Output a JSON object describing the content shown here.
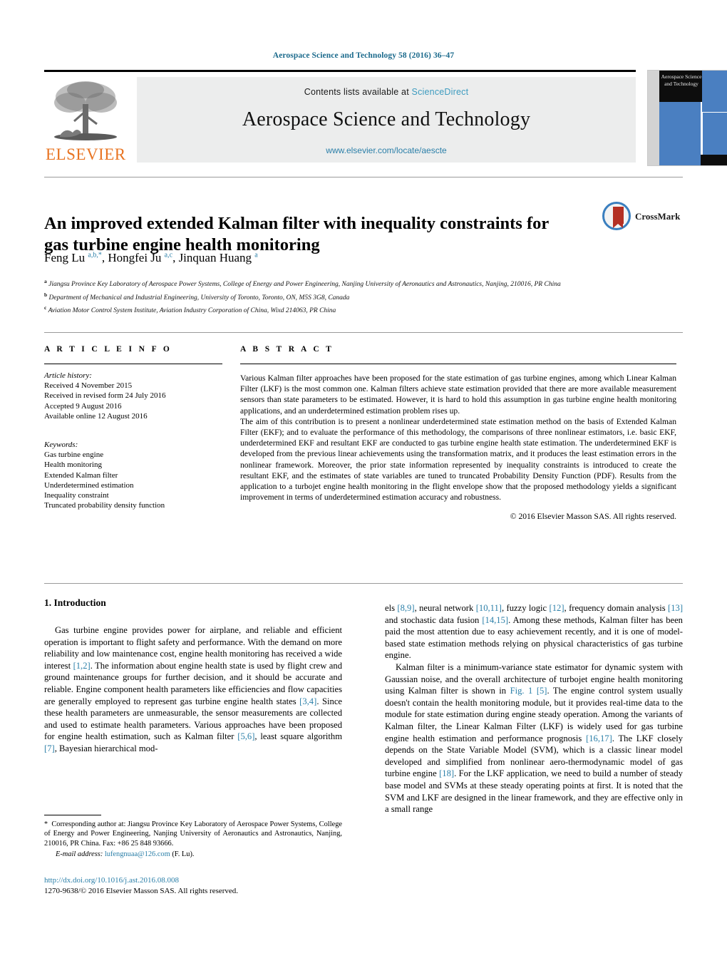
{
  "running_head": "Aerospace Science and Technology 58 (2016) 36–47",
  "masthead": {
    "contents_prefix": "Contents lists available at ",
    "sciencedirect": "ScienceDirect",
    "journal_title": "Aerospace Science and Technology",
    "journal_url": "www.elsevier.com/locate/aescte",
    "publisher_logo_text": "ELSEVIER",
    "cover_title": "Aerospace Science and Technology",
    "cover_caption": "Aerospace Science and Technology"
  },
  "article": {
    "title": "An improved extended Kalman filter with inequality constraints for gas turbine engine health monitoring",
    "crossmark_label": "CrossMark",
    "authors_html": "Feng Lu <sup>a,b,*</sup>, Hongfei Ju <sup>a,c</sup>, Jinquan Huang <sup>a</sup>",
    "affiliations": [
      "Jiangsu Province Key Laboratory of Aerospace Power Systems, College of Energy and Power Engineering, Nanjing University of Aeronautics and Astronautics, Nanjing, 210016, PR China",
      "Department of Mechanical and Industrial Engineering, University of Toronto, Toronto, ON, M5S 3G8, Canada",
      "Aviation Motor Control System Institute, Aviation Industry Corporation of China, Wixd 214063, PR China"
    ],
    "affiliation_marks": [
      "a",
      "b",
      "c"
    ]
  },
  "article_info": {
    "heading": "A R T I C L E  I N F O",
    "history_label": "Article history:",
    "history": [
      "Received 4 November 2015",
      "Received in revised form 24 July 2016",
      "Accepted 9 August 2016",
      "Available online 12 August 2016"
    ],
    "keywords_label": "Keywords:",
    "keywords": [
      "Gas turbine engine",
      "Health monitoring",
      "Extended Kalman filter",
      "Underdetermined estimation",
      "Inequality constraint",
      "Truncated probability density function"
    ]
  },
  "abstract": {
    "heading": "A B S T R A C T",
    "paragraphs": [
      "Various Kalman filter approaches have been proposed for the state estimation of gas turbine engines, among which Linear Kalman Filter (LKF) is the most common one. Kalman filters achieve state estimation provided that there are more available measurement sensors than state parameters to be estimated. However, it is hard to hold this assumption in gas turbine engine health monitoring applications, and an underdetermined estimation problem rises up.",
      "The aim of this contribution is to present a nonlinear underdetermined state estimation method on the basis of Extended Kalman Filter (EKF); and to evaluate the performance of this methodology, the comparisons of three nonlinear estimators, i.e. basic EKF, underdetermined EKF and resultant EKF are conducted to gas turbine engine health state estimation. The underdetermined EKF is developed from the previous linear achievements using the transformation matrix, and it produces the least estimation errors in the nonlinear framework. Moreover, the prior state information represented by inequality constraints is introduced to create the resultant EKF, and the estimates of state variables are tuned to truncated Probability Density Function (PDF). Results from the application to a turbojet engine health monitoring in the flight envelope show that the proposed methodology yields a significant improvement in terms of underdetermined estimation accuracy and robustness."
    ],
    "copyright": "© 2016 Elsevier Masson SAS. All rights reserved."
  },
  "introduction": {
    "heading": "1. Introduction",
    "left_paragraph_html": "Gas turbine engine provides power for airplane, and reliable and efficient operation is important to flight safety and performance. With the demand on more reliability and low maintenance cost, engine health monitoring has received a wide interest <span class=\"ref\">[1,2]</span>. The information about engine health state is used by flight crew and ground maintenance groups for further decision, and it should be accurate and reliable. Engine component health parameters like efficiencies and flow capacities are generally employed to represent gas turbine engine health states <span class=\"ref\">[3,4]</span>. Since these health parameters are unmeasurable, the sensor measurements are collected and used to estimate health parameters. Various approaches have been proposed for engine health estimation, such as Kalman filter <span class=\"ref\">[5,6]</span>, least square algorithm <span class=\"ref\">[7]</span>, Bayesian hierarchical mod-",
    "right_paragraph1_html": "els <span class=\"ref\">[8,9]</span>, neural network <span class=\"ref\">[10,11]</span>, fuzzy logic <span class=\"ref\">[12]</span>, frequency domain analysis <span class=\"ref\">[13]</span> and stochastic data fusion <span class=\"ref\">[14,15]</span>. Among these methods, Kalman filter has been paid the most attention due to easy achievement recently, and it is one of model-based state estimation methods relying on physical characteristics of gas turbine engine.",
    "right_paragraph2_html": "Kalman filter is a minimum-variance state estimator for dynamic system with Gaussian noise, and the overall architecture of turbojet engine health monitoring using Kalman filter is shown in <span class=\"ref\">Fig. 1</span> <span class=\"ref\">[5]</span>. The engine control system usually doesn't contain the health monitoring module, but it provides real-time data to the module for state estimation during engine steady operation. Among the variants of Kalman filter, the Linear Kalman Filter (LKF) is widely used for gas turbine engine health estimation and performance prognosis <span class=\"ref\">[16,17]</span>. The LKF closely depends on the State Variable Model (SVM), which is a classic linear model developed and simplified from nonlinear aero-thermodynamic model of gas turbine engine <span class=\"ref\">[18]</span>. For the LKF application, we need to build a number of steady base model and SVMs at these steady operating points at first. It is noted that the SVM and LKF are designed in the linear framework, and they are effective only in a small range"
  },
  "footer": {
    "corresponding_html": "<span class=\"star\">*</span>&nbsp; Corresponding author at: Jiangsu Province Key Laboratory of Aerospace Power Systems, College of Energy and Power Engineering, Nanjing University of Aeronautics and Astronautics, Nanjing, 210016, PR China. Fax: +86 25 848 93666.",
    "email_label": "E-mail address:",
    "email": "lufengnuaa@126.com",
    "email_suffix": "(F. Lu).",
    "doi": "http://dx.doi.org/10.1016/j.ast.2016.08.008",
    "issn_line": "1270-9638/© 2016 Elsevier Masson SAS. All rights reserved."
  },
  "colors": {
    "link": "#2b7fa8",
    "running_head": "#1b6a8c",
    "elsevier_orange": "#e87422",
    "cover_blue": "#4a7fc1",
    "crossmark_blue": "#3a7fbf",
    "crossmark_red": "#b43024"
  }
}
